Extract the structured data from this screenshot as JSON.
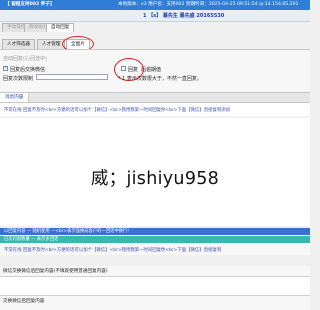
{
  "window": {
    "title": "【 留程支持002 养子】",
    "info": "本地版本：v3  用户名：支持002  到期时间：2025-04-25 09:51:54  ip:14.154.65.201"
  },
  "header": {
    "text": "1 【s】 暴先生   暴先盛 20165530"
  },
  "tabs_row1": [
    {
      "label": "手动操作"
    },
    {
      "label": "群发助力"
    },
    {
      "label": "自动回复"
    }
  ],
  "tabs_row2": [
    {
      "label": "人才筛选器"
    },
    {
      "label": "人才管理"
    },
    {
      "label": "全图片"
    }
  ],
  "settings": {
    "hint": "自动回复(心回选中)",
    "opt_label_1": "回复后交换微信",
    "opt_label_2": "回复",
    "opt_label_2_tail": "后逾期值",
    "field_label": "回复次数限制",
    "note": "* 1 表示次数限大于，不然一直回复。"
  },
  "section1": {
    "tab": "消息内容",
    "message": "不常在线 回复不及时<br>方便的话可以加个【微信】<br>我用我第一时间回复你<br>下面【微信】直接复制添加"
  },
  "watermark": "威；jishiyu958",
  "banners": {
    "blue": "以回复内容 — 随机使用 —<br>表示强换成客户的一回话中换行!",
    "teal": "已次内容数量 — 表示多回话"
  },
  "bottom": {
    "message": "不常在线 回复不及时<br>方便的话可以加个【微信】<br>我用我第一时间回复你<br>下面【微信】直接复制",
    "label1": "微信交换微信后回复内容(不填就使用普通回复内容)",
    "label2": "交换微信后回复内容"
  },
  "colors": {
    "titlebar": "#2f7dd6",
    "link_blue": "#1b3fb0",
    "annotation_red": "#e02020",
    "banner_blue": "#3b6fd1",
    "banner_teal": "#3ab7b0"
  }
}
